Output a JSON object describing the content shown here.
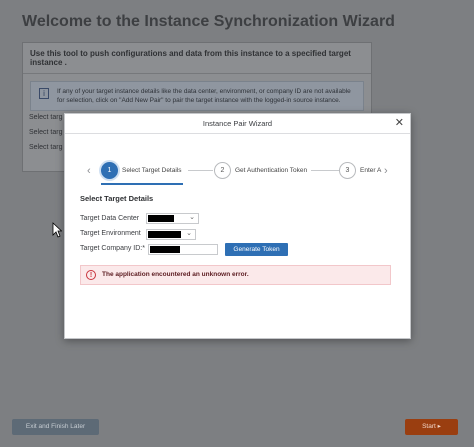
{
  "page": {
    "title": "Welcome to the Instance Synchronization Wizard",
    "intro": "Use this tool to push configurations and data from this instance to a specified target instance .",
    "info": "If any of your target instance details like the data center, environment, or company ID are not available for selection, click on \"Add New Pair\" to pair the target instance with the logged-in source instance.",
    "bg_labels": [
      "Select targ",
      "Select targ",
      "Select targ"
    ],
    "exit_label": "Exit and Finish Later",
    "start_label": "Start ▸"
  },
  "modal": {
    "title": "Instance Pair Wizard",
    "close": "✕",
    "steps": [
      {
        "num": "1",
        "label": "Select Target Details",
        "active": true
      },
      {
        "num": "2",
        "label": "Get Authentication Token",
        "active": false
      },
      {
        "num": "3",
        "label": "Enter A",
        "active": false
      }
    ],
    "prev_arrow": "‹",
    "next_arrow": "›",
    "section_title": "Select Target Details",
    "fields": {
      "data_center_label": "Target Data Center",
      "environment_label": "Target Environment",
      "company_id_label": "Target Company ID:*"
    },
    "generate_label": "Generate Token",
    "error_icon": "!",
    "error_text": "The application encountered an unknown error."
  },
  "colors": {
    "primary": "#2e6fb4",
    "start_button": "#9a3e10",
    "error_bg": "#fbe9ea",
    "error_icon": "#c9343d"
  }
}
